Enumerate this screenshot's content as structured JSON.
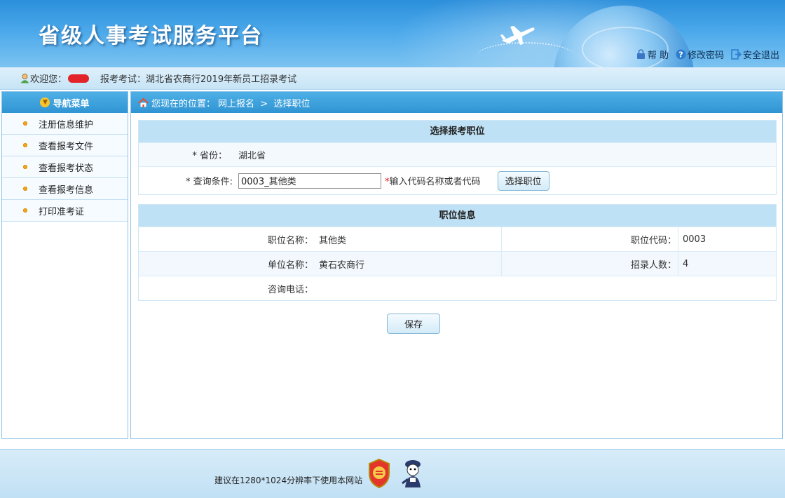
{
  "header": {
    "title": "省级人事考试服务平台",
    "links": {
      "help": "帮 助",
      "change_password": "修改密码",
      "logout": "安全退出"
    }
  },
  "welcome": {
    "greeting": "欢迎您：",
    "exam_label": "报考考试：湖北省农商行2019年新员工招录考试"
  },
  "sidebar": {
    "title": "导航菜单",
    "items": [
      {
        "label": "注册信息维护"
      },
      {
        "label": "查看报考文件"
      },
      {
        "label": "查看报考状态"
      },
      {
        "label": "查看报考信息"
      },
      {
        "label": "打印准考证"
      }
    ]
  },
  "breadcrumb": {
    "prefix": "您现在的位置：",
    "path": "网上报名  >  选择职位"
  },
  "select_section": {
    "title": "选择报考职位",
    "province_label": "* 省份：",
    "province_value": "湖北省",
    "query_label": "* 查询条件:",
    "query_value": "0003_其他类",
    "hint_star": "*",
    "hint_text": "输入代码名称或者代码",
    "select_button": "选择职位"
  },
  "position_info": {
    "title": "职位信息",
    "name_label": "职位名称：",
    "name_value": "其他类",
    "code_label": "职位代码：",
    "code_value": "0003",
    "unit_label": "单位名称：",
    "unit_value": "黄石农商行",
    "count_label": "招录人数：",
    "count_value": "4",
    "phone_label": "咨询电话：",
    "phone_value": ""
  },
  "actions": {
    "save": "保存"
  },
  "footer": {
    "text": "建议在1280*1024分辨率下使用本网站"
  },
  "colors": {
    "header_blue": "#2f94d3",
    "panel_title_bg": "#bfe1f5",
    "required_red": "#e02020"
  }
}
